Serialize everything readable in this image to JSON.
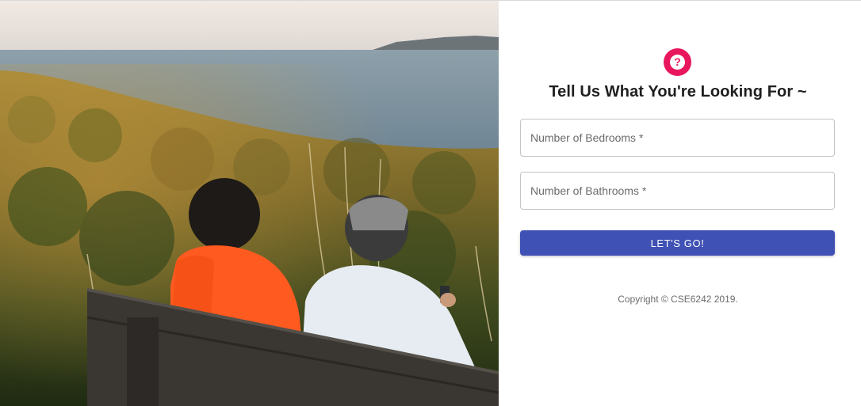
{
  "form": {
    "icon": "help-circle-icon",
    "title": "Tell Us What You're Looking For ~",
    "bedrooms_label": "Number of Bedrooms *",
    "bathrooms_label": "Number of Bathrooms *",
    "submit_label": "LET'S GO!",
    "copyright": "Copyright © CSE6242 2019."
  },
  "colors": {
    "accent_pink": "#e8175d",
    "primary_button": "#3f51b5"
  }
}
